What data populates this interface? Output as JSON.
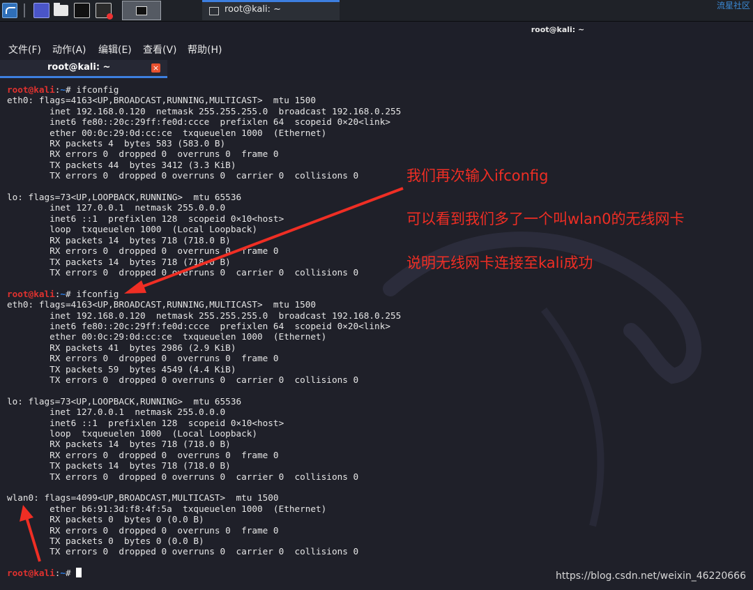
{
  "taskbar": {
    "icons": [
      "kali-menu-icon",
      "show-desktop-icon",
      "file-manager-icon",
      "terminal-icon",
      "screen-recorder-icon"
    ],
    "window_label": "root@kali: ~",
    "corner_label": "流星社区"
  },
  "window": {
    "title": "root@kali: ~"
  },
  "menu": {
    "items": [
      "文件(F)",
      "动作(A)",
      "编辑(E)",
      "查看(V)",
      "帮助(H)"
    ]
  },
  "tab": {
    "label": "root@kali: ~",
    "close": "×"
  },
  "terminal": {
    "prompt_user": "root@kali",
    "prompt_sep": ":",
    "prompt_path": "~",
    "prompt_symbol": "# ",
    "command": "ifconfig",
    "block1": "eth0: flags=4163<UP,BROADCAST,RUNNING,MULTICAST>  mtu 1500\n        inet 192.168.0.120  netmask 255.255.255.0  broadcast 192.168.0.255\n        inet6 fe80::20c:29ff:fe0d:ccce  prefixlen 64  scopeid 0×20<link>\n        ether 00:0c:29:0d:cc:ce  txqueuelen 1000  (Ethernet)\n        RX packets 4  bytes 583 (583.0 B)\n        RX errors 0  dropped 0  overruns 0  frame 0\n        TX packets 44  bytes 3412 (3.3 KiB)\n        TX errors 0  dropped 0 overruns 0  carrier 0  collisions 0\n\nlo: flags=73<UP,LOOPBACK,RUNNING>  mtu 65536\n        inet 127.0.0.1  netmask 255.0.0.0\n        inet6 ::1  prefixlen 128  scopeid 0×10<host>\n        loop  txqueuelen 1000  (Local Loopback)\n        RX packets 14  bytes 718 (718.0 B)\n        RX errors 0  dropped 0  overruns 0  frame 0\n        TX packets 14  bytes 718 (718.0 B)\n        TX errors 0  dropped 0 overruns 0  carrier 0  collisions 0\n",
    "block2": "eth0: flags=4163<UP,BROADCAST,RUNNING,MULTICAST>  mtu 1500\n        inet 192.168.0.120  netmask 255.255.255.0  broadcast 192.168.0.255\n        inet6 fe80::20c:29ff:fe0d:ccce  prefixlen 64  scopeid 0×20<link>\n        ether 00:0c:29:0d:cc:ce  txqueuelen 1000  (Ethernet)\n        RX packets 41  bytes 2986 (2.9 KiB)\n        RX errors 0  dropped 0  overruns 0  frame 0\n        TX packets 59  bytes 4549 (4.4 KiB)\n        TX errors 0  dropped 0 overruns 0  carrier 0  collisions 0\n\nlo: flags=73<UP,LOOPBACK,RUNNING>  mtu 65536\n        inet 127.0.0.1  netmask 255.0.0.0\n        inet6 ::1  prefixlen 128  scopeid 0×10<host>\n        loop  txqueuelen 1000  (Local Loopback)\n        RX packets 14  bytes 718 (718.0 B)\n        RX errors 0  dropped 0  overruns 0  frame 0\n        TX packets 14  bytes 718 (718.0 B)\n        TX errors 0  dropped 0 overruns 0  carrier 0  collisions 0\n\nwlan0: flags=4099<UP,BROADCAST,MULTICAST>  mtu 1500\n        ether b6:91:3d:f8:4f:5a  txqueuelen 1000  (Ethernet)\n        RX packets 0  bytes 0 (0.0 B)\n        RX errors 0  dropped 0  overruns 0  frame 0\n        TX packets 0  bytes 0 (0.0 B)\n        TX errors 0  dropped 0 overruns 0  carrier 0  collisions 0\n"
  },
  "annotations": {
    "line1": "我们再次输入ifconfig",
    "line2": "可以看到我们多了一个叫wlan0的无线网卡",
    "line3": "说明无线网卡连接至kali成功",
    "arrow_color": "#ef2e24"
  },
  "watermark": "https://blog.csdn.net/weixin_46220666",
  "colors": {
    "prompt_user": "#e0322f",
    "prompt_path": "#2f7fe6",
    "accent": "#3d7fe0"
  }
}
